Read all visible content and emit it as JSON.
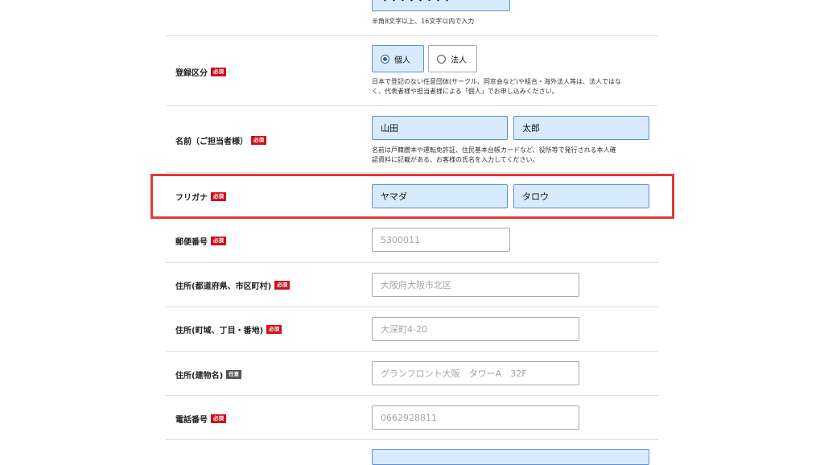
{
  "password": {
    "value": "・・・・・・・・",
    "help": "半角8文字以上、16文字以内で入力"
  },
  "registration": {
    "label": "登録区分",
    "badge": "必須",
    "options": [
      {
        "label": "個人",
        "selected": true
      },
      {
        "label": "法人",
        "selected": false
      }
    ],
    "help_line1": "日本で登記のない任意団体(サークル、同窓会など)や組合・海外法人等は、法人ではな",
    "help_line2": "く、代表者様や担当者様による「個人」でお申し込みください。"
  },
  "name": {
    "label": "名前（ご担当者様）",
    "badge": "必須",
    "last": "山田",
    "first": "太郎",
    "help_line1": "名前は戸籍謄本や運転免許証、住民基本台帳カードなど、役所等で発行される本人確",
    "help_line2": "認資料に記載がある、お客様の氏名を入力してください。"
  },
  "furigana": {
    "label": "フリガナ",
    "badge": "必須",
    "last": "ヤマダ",
    "first": "タロウ"
  },
  "postal": {
    "label": "郵便番号",
    "badge": "必須",
    "placeholder": "5300011"
  },
  "address1": {
    "label": "住所(都道府県、市区町村)",
    "badge": "必須",
    "placeholder": "大阪府大阪市北区"
  },
  "address2": {
    "label": "住所(町域、丁目・番地)",
    "badge": "必須",
    "placeholder": "大深町4-20"
  },
  "address3": {
    "label": "住所(建物名)",
    "badge": "任意",
    "placeholder": "グランフロント大阪　タワーA　32F"
  },
  "phone": {
    "label": "電話番号",
    "badge": "必須",
    "placeholder": "0662928811"
  },
  "colors": {
    "required_badge": "#d0101b",
    "optional_badge": "#555555",
    "filled_bg": "#d8eafd",
    "highlight": "#e53935"
  }
}
